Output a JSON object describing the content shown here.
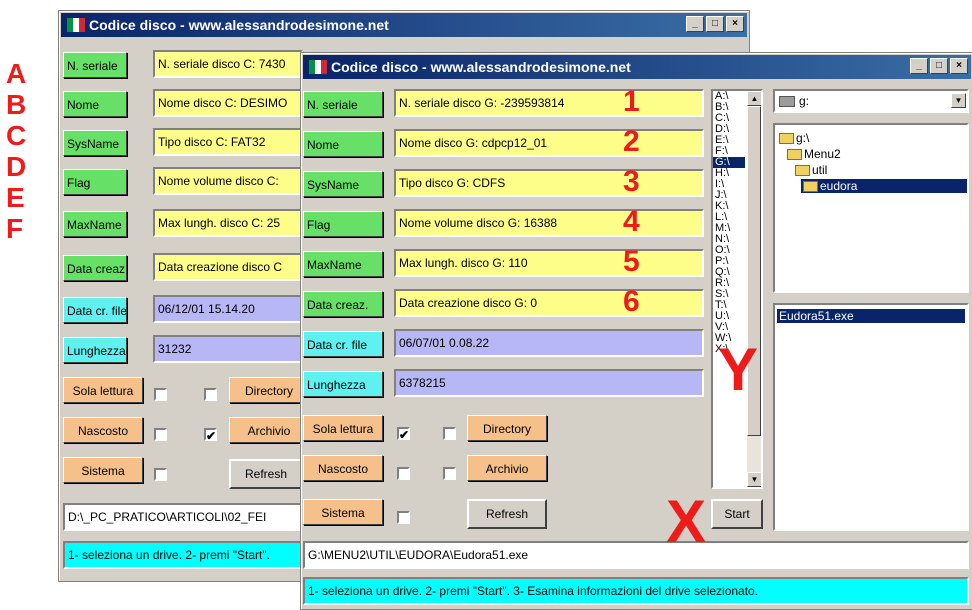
{
  "side_letters": [
    "A",
    "B",
    "C",
    "D",
    "E",
    "F"
  ],
  "back_window": {
    "title": "Codice disco - www.alessandrodesimone.net",
    "title_buttons": [
      "_",
      "□",
      "×"
    ],
    "labels": [
      "N. seriale",
      "Nome",
      "SysName",
      "Flag",
      "MaxName",
      "Data creaz.",
      "Data cr. file",
      "Lunghezza"
    ],
    "fields": [
      "N. seriale disco C: 7430",
      "Nome disco C: DESIMO",
      "Tipo  disco C: FAT32",
      "Nome volume disco C:",
      "Max lungh. disco C: 25",
      "Data creazione disco C",
      "06/12/01 15.14.20",
      "31232"
    ],
    "attr_labels": [
      "Sola lettura",
      "Nascosto",
      "Sistema"
    ],
    "attr_checks_left": [
      "",
      "",
      ""
    ],
    "attr_checks_right": [
      "",
      "✔"
    ],
    "attr_right_labels": [
      "Directory",
      "Archivio"
    ],
    "refresh_label": "Refresh",
    "path": "D:\\_PC_PRATICO\\ARTICOLI\\02_FEI",
    "status": "1- seleziona un drive. 2- premi \"Start\"."
  },
  "front_window": {
    "title": "Codice disco - www.alessandrodesimone.net",
    "title_buttons": [
      "_",
      "□",
      "×"
    ],
    "labels": [
      "N. seriale",
      "Nome",
      "SysName",
      "Flag",
      "MaxName",
      "Data creaz.",
      "Data cr. file",
      "Lunghezza"
    ],
    "fields": [
      "N. seriale disco G: -239593814",
      "Nome disco G: cdpcp12_01",
      "Tipo  disco G: CDFS",
      "Nome volume disco G: 16388",
      "Max lungh. disco G: 110",
      "Data creazione disco G: 0",
      "06/07/01 0.08.22",
      "6378215"
    ],
    "field_numbers": [
      "1",
      "2",
      "3",
      "4",
      "5",
      "6"
    ],
    "attr_labels": [
      "Sola lettura",
      "Nascosto",
      "Sistema"
    ],
    "attr_checks_left": [
      "✔",
      "",
      ""
    ],
    "attr_checks_right": [
      "",
      ""
    ],
    "attr_right_labels": [
      "Directory",
      "Archivio"
    ],
    "refresh_label": "Refresh",
    "start_label": "Start",
    "drives": [
      "A:\\",
      "B:\\",
      "C:\\",
      "D:\\",
      "E:\\",
      "F:\\",
      "G:\\",
      "H:\\",
      "I:\\",
      "J:\\",
      "K:\\",
      "L:\\",
      "M:\\",
      "N:\\",
      "O:\\",
      "P:\\",
      "Q:\\",
      "R:\\",
      "S:\\",
      "T:\\",
      "U:\\",
      "V:\\",
      "W:\\",
      "X:\\"
    ],
    "selected_drive": "G:\\",
    "drive_combo": "g:",
    "tree": [
      "g:\\",
      "Menu2",
      "util",
      "eudora"
    ],
    "file_list": [
      "Eudora51.exe"
    ],
    "path": "G:\\MENU2\\UTIL\\EUDORA\\Eudora51.exe",
    "status": "1- seleziona un drive. 2- premi \"Start\". 3- Esamina informazioni del drive selezionato."
  },
  "marks": {
    "x": "X",
    "y": "Y"
  },
  "colors": {
    "title_bar": "#0a246a",
    "mark_red": "#ee1b1b",
    "label_green": "#66e066",
    "label_cyan": "#5ff0f0",
    "label_orange": "#f5c08a",
    "field_yellow": "#fdfd8a",
    "field_lavender": "#b7b7f5",
    "status_cyan": "#00ffff"
  }
}
